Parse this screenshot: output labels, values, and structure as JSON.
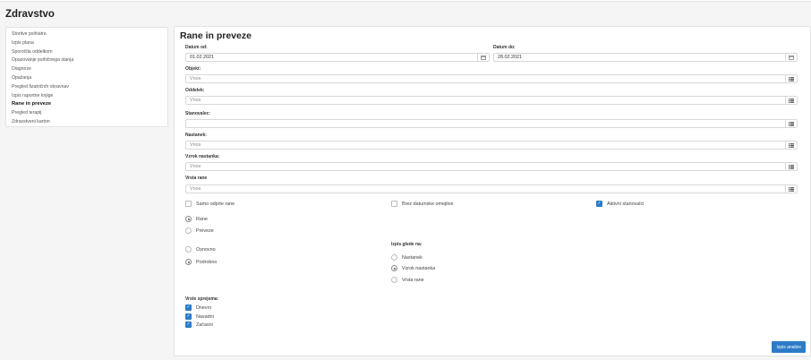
{
  "app": {
    "title": "Zdravstvo"
  },
  "sidebar": {
    "items": [
      {
        "label": "Storitve psihiatra"
      },
      {
        "label": "Izpis plana"
      },
      {
        "label": "Sporočila oddelkom"
      },
      {
        "label": "Opazovanje psihičnega stanja"
      },
      {
        "label": "Diagnoze"
      },
      {
        "label": "Opažanja"
      },
      {
        "label": "Pregled fizatričnih obravnav"
      },
      {
        "label": "Izpis raportne knjige"
      },
      {
        "label": "Rane in preveze",
        "active": true
      },
      {
        "label": "Pregled terapij"
      },
      {
        "label": "Zdravstveni karton"
      }
    ]
  },
  "form": {
    "title": "Rane in preveze",
    "date_from": {
      "label": "Datum od:",
      "value": "01.02.2021"
    },
    "date_to": {
      "label": "Datum do:",
      "value": "28.02.2021"
    },
    "objekt": {
      "label": "Objekt:",
      "placeholder": "Vnos"
    },
    "oddelek": {
      "label": "Oddelek:",
      "placeholder": "Vnos"
    },
    "stanovalec": {
      "label": "Stanovalec:",
      "placeholder": ""
    },
    "nastanek": {
      "label": "Nastanek:",
      "placeholder": "Vnos"
    },
    "vzrok": {
      "label": "Vzrok nastanka:",
      "placeholder": "Vnos"
    },
    "vrsta": {
      "label": "Vrsta rane",
      "placeholder": "Vnos"
    },
    "checks": {
      "samo_odprte": {
        "label": "Samo odprte rane",
        "checked": false
      },
      "brez_omejitve": {
        "label": "Brez datumske omejitve",
        "checked": false
      },
      "aktivni": {
        "label": "Aktivni stanovalci",
        "checked": true
      }
    },
    "type_radio": [
      {
        "label": "Rane",
        "checked": true
      },
      {
        "label": "Preveze",
        "checked": false
      }
    ],
    "detail_radio": [
      {
        "label": "Osnovno",
        "checked": false
      },
      {
        "label": "Podrobno",
        "checked": true
      }
    ],
    "group_by": {
      "label": "Izpis glede na:",
      "options": [
        {
          "label": "Nastanek",
          "checked": false
        },
        {
          "label": "Vzrok nastanka",
          "checked": true
        },
        {
          "label": "Vrsta rane",
          "checked": false
        }
      ]
    },
    "admission": {
      "label": "Vrste sprejema:",
      "options": [
        {
          "label": "Dnevni",
          "checked": true
        },
        {
          "label": "Navadni",
          "checked": true
        },
        {
          "label": "Začasni",
          "checked": true
        }
      ]
    },
    "submit_label": "Izpis analize"
  },
  "icons": {
    "calendar": "calendar-icon",
    "list": "list-icon",
    "check": "check-icon"
  },
  "colors": {
    "accent": "#2a7bc8"
  }
}
